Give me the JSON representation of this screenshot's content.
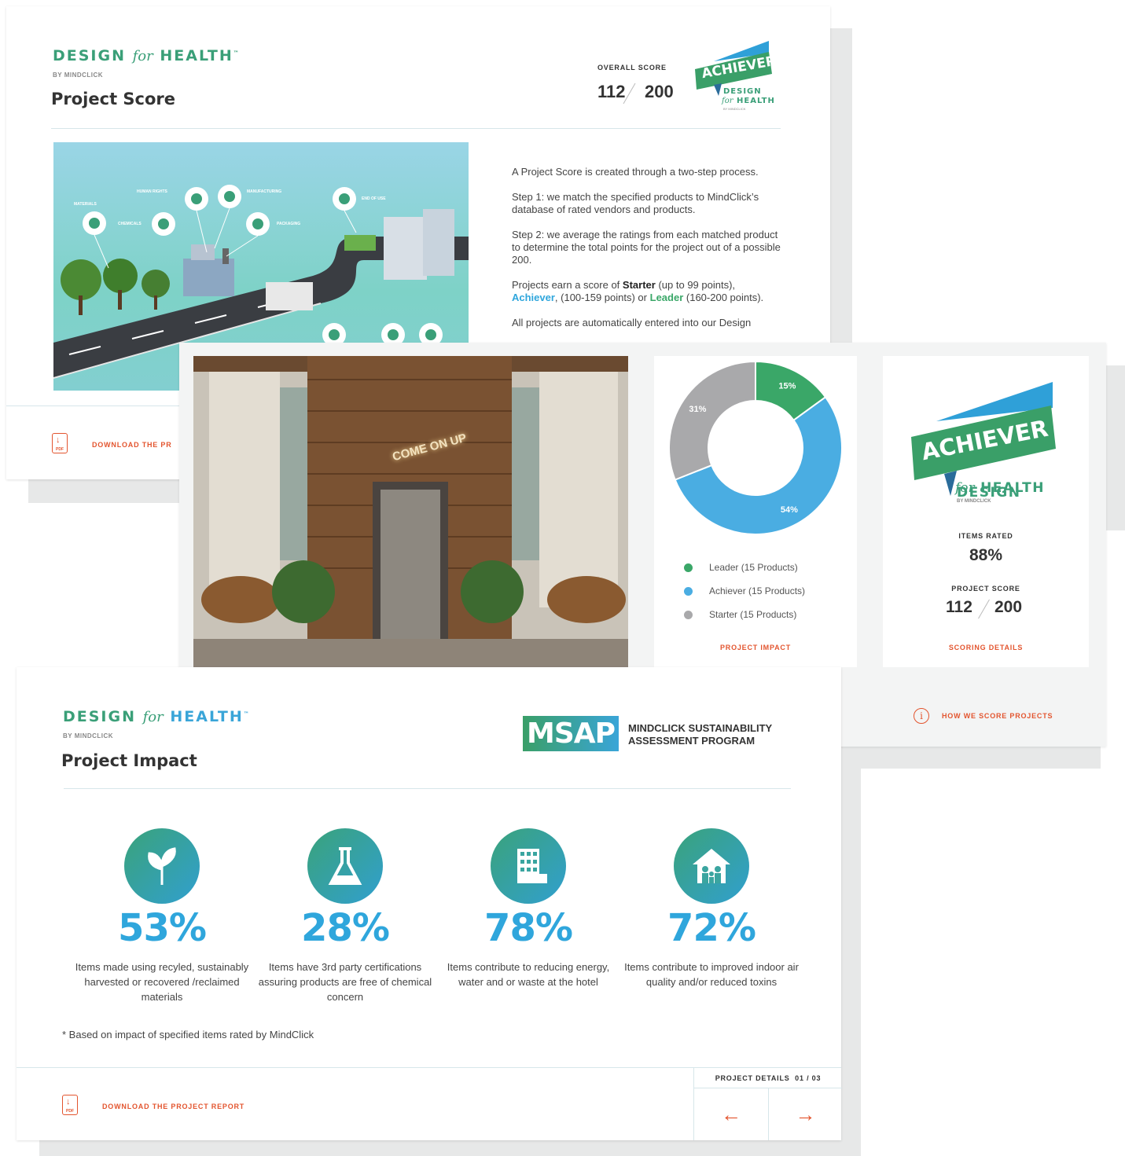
{
  "brand": {
    "word_design": "DESIGN",
    "word_for": "for",
    "word_health": "HEALTH",
    "trademark": "™",
    "byline": "BY MINDCLICK",
    "colors": {
      "green": "#3a9f78",
      "blue": "#3aa5d8",
      "accent_orange": "#e3552f"
    }
  },
  "score_page": {
    "title": "Project Score",
    "overall_score_label": "OVERALL SCORE",
    "score": "112",
    "score_max": "200",
    "badge": {
      "label": "ACHIEVER",
      "sub1": "DESIGN",
      "sub2_for": "for",
      "sub2_health": "HEALTH",
      "byline": "BY MINDCLICK"
    },
    "illustration_labels": [
      "MATERIALS",
      "HUMAN RIGHTS",
      "MANUFACTURING",
      "CHEMICALS",
      "PACKAGING",
      "END OF USE"
    ],
    "intro": "A Project Score is created through a two-step process.",
    "step1": "Step 1: we match the specified products to MindClick’s database of rated vendors and products.",
    "step2": "Step 2: we average the ratings from each matched product to determine the total points for the project out of a possible 200.",
    "tiers_prefix": "Projects earn a score of",
    "tier_starter": "Starter",
    "tier_starter_range": "(up to 99 points),",
    "tier_achiever": "Achiever",
    "tier_achiever_range": ", (100-159 points) or",
    "tier_leader": "Leader",
    "tier_leader_range": "(160-200 points).",
    "cut_text": "All projects are automatically entered into our Design",
    "download_label": "DOWNLOAD THE PR"
  },
  "summary_panel": {
    "photo_sign": "COME ON UP",
    "chart_link": "PROJECT IMPACT",
    "legend": [
      {
        "label": "Leader (15 Products)",
        "color": "#3aa768"
      },
      {
        "label": "Achiever (15 Products)",
        "color": "#4aade2"
      },
      {
        "label": "Starter (15 Products)",
        "color": "#a9a9ab"
      }
    ],
    "badge": {
      "label": "ACHIEVER",
      "sub1": "DESIGN",
      "sub2_for": "for",
      "sub2_health": "HEALTH",
      "byline": "BY MINDCLICK"
    },
    "items_rated_label": "ITEMS RATED",
    "items_rated_value": "88%",
    "project_score_label": "PROJECT SCORE",
    "project_score": "112",
    "project_score_max": "200",
    "scoring_link": "SCORING DETAILS",
    "how_link": "HOW WE SCORE PROJECTS"
  },
  "chart_data": {
    "type": "pie",
    "donut": true,
    "slices": [
      {
        "label": "Leader (15 Products)",
        "value": 15,
        "display": "15%",
        "color": "#3aa768"
      },
      {
        "label": "Achiever (15 Products)",
        "value": 54,
        "display": "54%",
        "color": "#4aade2"
      },
      {
        "label": "Starter (15 Products)",
        "value": 31,
        "display": "31%",
        "color": "#a9a9ab"
      }
    ]
  },
  "impact_page": {
    "title": "Project Impact",
    "msap_logo": "MSAP",
    "msap_line1": "MINDCLICK SUSTAINABILITY",
    "msap_line2": "ASSESSMENT PROGRAM",
    "stats": [
      {
        "pct": "53%",
        "desc": "Items made using recyled, sustainably harvested or recovered /reclaimed materials",
        "icon": "plant-icon"
      },
      {
        "pct": "28%",
        "desc": "Items have 3rd party certifications assuring products are free of chemical concern",
        "icon": "flask-icon"
      },
      {
        "pct": "78%",
        "desc": "Items contribute to reducing energy, water and or waste at the hotel",
        "icon": "building-icon"
      },
      {
        "pct": "72%",
        "desc": "Items contribute to improved indoor air quality and/or reduced toxins",
        "icon": "family-home-icon"
      }
    ],
    "footnote": "* Based on impact of specified items rated by MindClick",
    "download_label": "DOWNLOAD THE PROJECT REPORT",
    "details_label": "PROJECT DETAILS",
    "details_page": "01 / 03",
    "prev_arrow": "←",
    "next_arrow": "→"
  }
}
